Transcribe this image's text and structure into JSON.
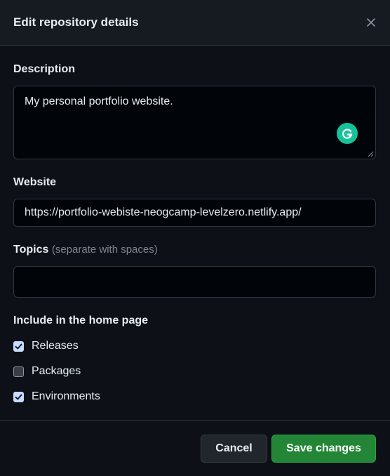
{
  "dialog": {
    "title": "Edit repository details"
  },
  "description": {
    "label": "Description",
    "value": "My personal portfolio website."
  },
  "website": {
    "label": "Website",
    "value": "https://portfolio-webiste-neogcamp-levelzero.netlify.app/"
  },
  "topics": {
    "label": "Topics",
    "hint": "(separate with spaces)",
    "value": ""
  },
  "home_page": {
    "label": "Include in the home page",
    "options": [
      {
        "label": "Releases",
        "checked": true
      },
      {
        "label": "Packages",
        "checked": false
      },
      {
        "label": "Environments",
        "checked": true
      }
    ]
  },
  "footer": {
    "cancel_label": "Cancel",
    "save_label": "Save changes"
  },
  "colors": {
    "accent_green": "#238636",
    "grammarly_green": "#15c39a",
    "checkbox_checked": "#c7dcff"
  },
  "icons": {
    "close": "close-icon",
    "grammarly": "grammarly-icon",
    "check": "check-icon"
  }
}
